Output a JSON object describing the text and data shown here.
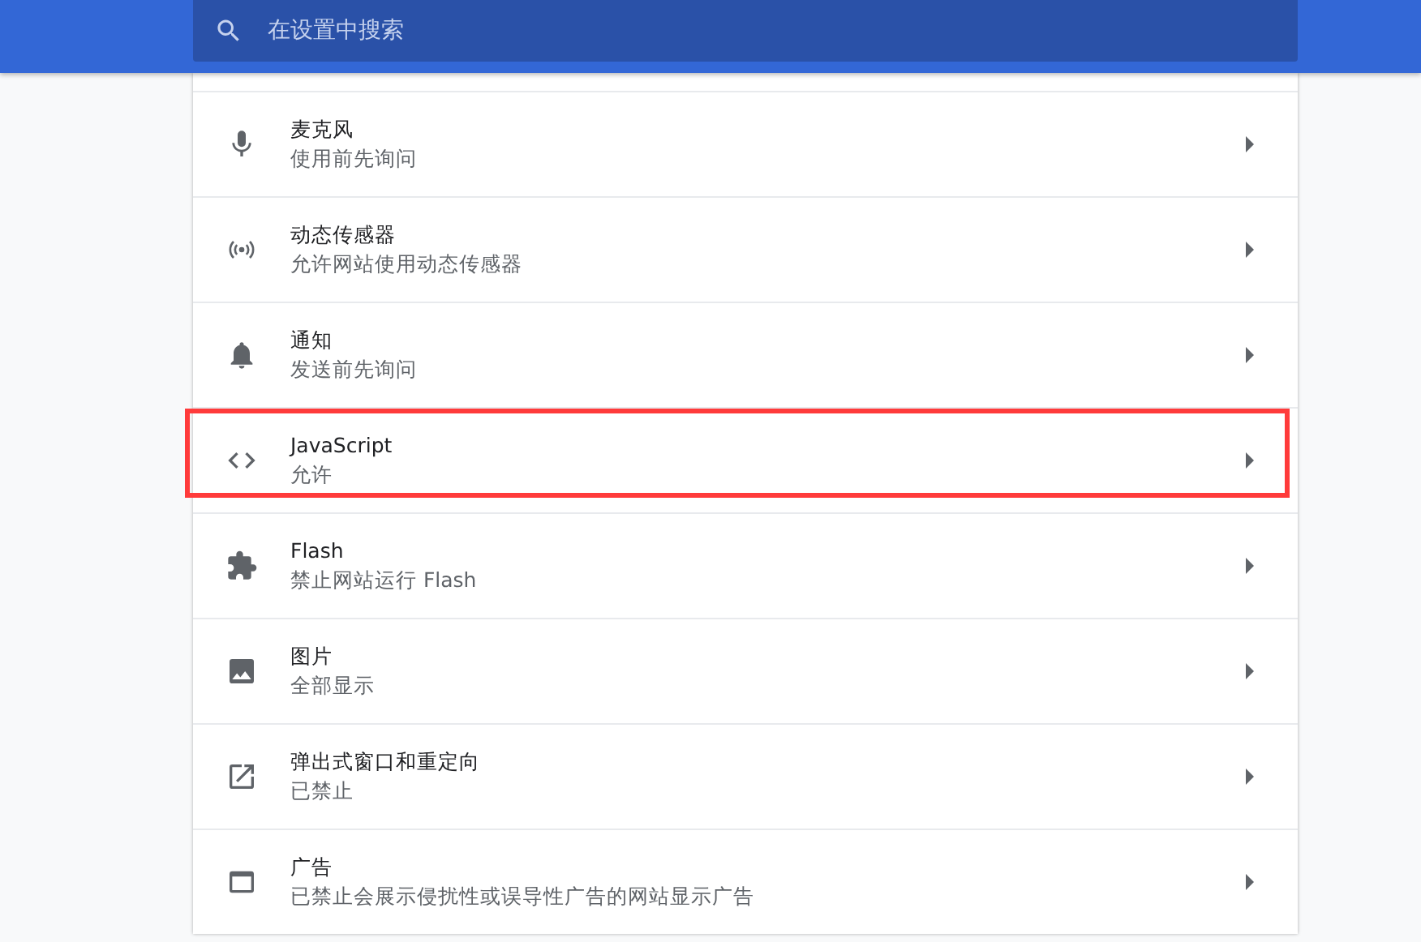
{
  "search": {
    "placeholder": "在设置中搜索"
  },
  "items": [
    {
      "title": "麦克风",
      "subtitle": "使用前先询问",
      "highlighted": false
    },
    {
      "title": "动态传感器",
      "subtitle": "允许网站使用动态传感器",
      "highlighted": false
    },
    {
      "title": "通知",
      "subtitle": "发送前先询问",
      "highlighted": false
    },
    {
      "title": "JavaScript",
      "subtitle": "允许",
      "highlighted": true
    },
    {
      "title": "Flash",
      "subtitle": "禁止网站运行 Flash",
      "highlighted": false
    },
    {
      "title": "图片",
      "subtitle": "全部显示",
      "highlighted": false
    },
    {
      "title": "弹出式窗口和重定向",
      "subtitle": "已禁止",
      "highlighted": false
    },
    {
      "title": "广告",
      "subtitle": "已禁止会展示侵扰性或误导性广告的网站显示广告",
      "highlighted": false
    }
  ]
}
